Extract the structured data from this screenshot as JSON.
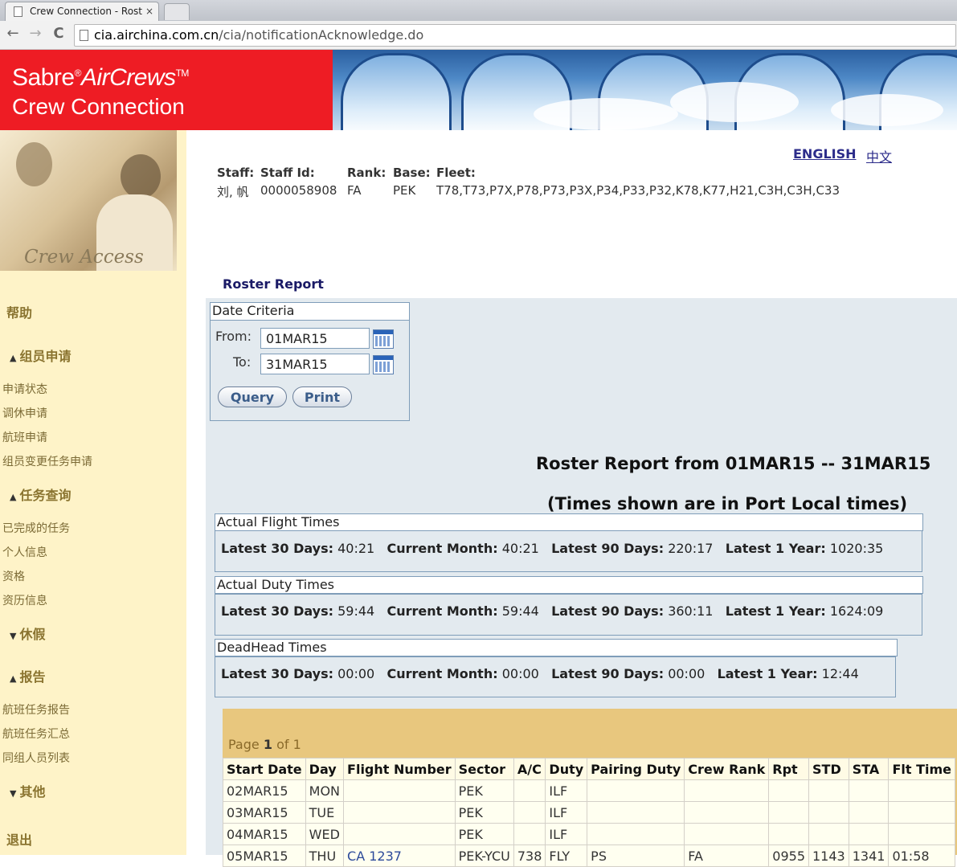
{
  "browser": {
    "tab_title": "Crew Connection - Rost",
    "tab_close": "×",
    "url_host": "cia.airchina.com.cn",
    "url_path": "/cia/notificationAcknowledge.do",
    "back": "←",
    "forward": "→",
    "reload": "C"
  },
  "banner": {
    "brand_line1": "Sabre",
    "brand_reg": "®",
    "brand_line1b": "AirCrews",
    "brand_tm": "TM",
    "brand_line2": "Crew Connection",
    "photo_caption": "Crew Access"
  },
  "sidebar": {
    "help": "帮助",
    "sec1": "组员申请",
    "sec1_items": [
      "申请状态",
      "调休申请",
      "航班申请",
      "组员变更任务申请"
    ],
    "sec2": "任务查询",
    "sec2_items": [
      "已完成的任务",
      "个人信息",
      "资格",
      "资历信息"
    ],
    "sec3": "休假",
    "sec4": "报告",
    "sec4_items": [
      "航班任务报告",
      "航班任务汇总",
      "同组人员列表"
    ],
    "sec5": "其他",
    "logout": "退出",
    "arrow_up": "▲",
    "arrow_down": "▼"
  },
  "header": {
    "lang_en": "ENGLISH",
    "lang_zh": "中文",
    "staff_label": "Staff:",
    "staff_id_label": "Staff Id:",
    "rank_label": "Rank:",
    "base_label": "Base:",
    "fleet_label": "Fleet:",
    "staff_value": "刘, 帆",
    "staff_id_value": "0000058908",
    "rank_value": "FA",
    "base_value": "PEK",
    "fleet_value": "T78,T73,P7X,P78,P73,P3X,P34,P33,P32,K78,K77,H21,C3H,C3H,C33"
  },
  "report": {
    "section_title": "Roster Report",
    "criteria_legend": "Date Criteria",
    "from_label": "From:",
    "to_label": "To:",
    "from_value": "01MAR15",
    "to_value": "31MAR15",
    "query_button": "Query",
    "print_button": "Print",
    "heading": "Roster Report from 01MAR15 -- 31MAR15",
    "subheading": "(Times shown are in Port Local times)"
  },
  "flight_times": {
    "legend": "Actual Flight Times",
    "l30_label": "Latest 30 Days:",
    "l30": "40:21",
    "cm_label": "Current Month:",
    "cm": "40:21",
    "l90_label": "Latest 90 Days:",
    "l90": "220:17",
    "l1y_label": "Latest 1 Year:",
    "l1y": "1020:35"
  },
  "duty_times": {
    "legend": "Actual Duty Times",
    "l30_label": "Latest 30 Days:",
    "l30": "59:44",
    "cm_label": "Current Month:",
    "cm": "59:44",
    "l90_label": "Latest 90 Days:",
    "l90": "360:11",
    "l1y_label": "Latest 1 Year:",
    "l1y": "1624:09"
  },
  "deadhead_times": {
    "legend": "DeadHead Times",
    "l30_label": "Latest 30 Days:",
    "l30": "00:00",
    "cm_label": "Current Month:",
    "cm": "00:00",
    "l90_label": "Latest 90 Days:",
    "l90": "00:00",
    "l1y_label": "Latest 1 Year:",
    "l1y": "12:44"
  },
  "pager": {
    "prefix": "Page",
    "current": "1",
    "of": "of 1"
  },
  "table": {
    "columns": [
      "Start Date",
      "Day",
      "Flight Number",
      "Sector",
      "A/C",
      "Duty",
      "Pairing Duty",
      "Crew Rank",
      "Rpt",
      "STD",
      "STA",
      "Flt Time"
    ],
    "rows": [
      [
        "02MAR15",
        "MON",
        "",
        "PEK",
        "",
        "ILF",
        "",
        "",
        "",
        "",
        "",
        ""
      ],
      [
        "03MAR15",
        "TUE",
        "",
        "PEK",
        "",
        "ILF",
        "",
        "",
        "",
        "",
        "",
        ""
      ],
      [
        "04MAR15",
        "WED",
        "",
        "PEK",
        "",
        "ILF",
        "",
        "",
        "",
        "",
        "",
        ""
      ],
      [
        "05MAR15",
        "THU",
        "CA 1237",
        "PEK-YCU",
        "738",
        "FLY",
        "PS",
        "FA",
        "0955",
        "1143",
        "1341",
        "01:58"
      ]
    ]
  }
}
